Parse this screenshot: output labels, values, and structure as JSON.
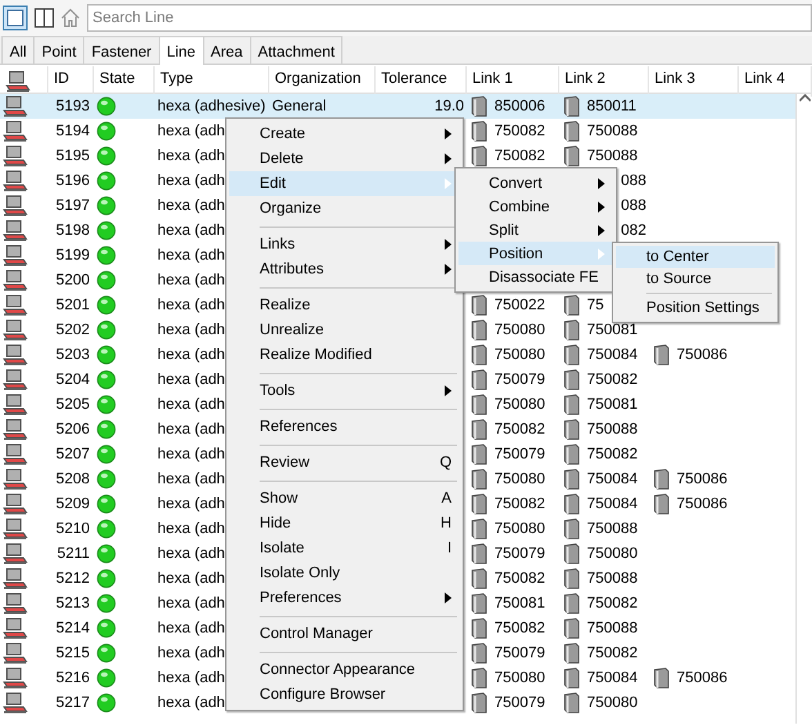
{
  "toolbar": {
    "search": {
      "placeholder": "Search Line"
    }
  },
  "tabs": [
    {
      "label": "All",
      "selected": false
    },
    {
      "label": "Point",
      "selected": false
    },
    {
      "label": "Fastener",
      "selected": false
    },
    {
      "label": "Line",
      "selected": true
    },
    {
      "label": "Area",
      "selected": false
    },
    {
      "label": "Attachment",
      "selected": false
    }
  ],
  "table": {
    "columns": [
      "ID",
      "State",
      "Type",
      "Organization",
      "Tolerance",
      "Link 1",
      "Link 2",
      "Link 3",
      "Link 4"
    ],
    "rows": [
      {
        "id": "5193",
        "type": "hexa (adhesive)",
        "organization": "General",
        "tolerance": "19.0",
        "selected": true,
        "links": [
          {
            "kind": "link",
            "value": "850006"
          },
          {
            "kind": "link",
            "value": "850011"
          }
        ]
      },
      {
        "id": "5194",
        "type": "hexa (adh",
        "selected": false,
        "links": [
          {
            "kind": "link",
            "value": "750082"
          },
          {
            "kind": "link",
            "value": "750088"
          }
        ]
      },
      {
        "id": "5195",
        "type": "hexa (adh",
        "selected": false,
        "links": [
          {
            "kind": "link",
            "value": "750082"
          },
          {
            "kind": "link",
            "value": "750088"
          }
        ]
      },
      {
        "id": "5196",
        "type": "hexa (adh",
        "selected": false,
        "links": [
          {
            "kind": "hidden"
          },
          {
            "kind": "partial",
            "value": "088"
          }
        ]
      },
      {
        "id": "5197",
        "type": "hexa (adh",
        "selected": false,
        "links": [
          {
            "kind": "hidden"
          },
          {
            "kind": "partial",
            "value": "088"
          }
        ]
      },
      {
        "id": "5198",
        "type": "hexa (adh",
        "selected": false,
        "links": [
          {
            "kind": "hidden"
          },
          {
            "kind": "partial",
            "value": "082"
          }
        ]
      },
      {
        "id": "5199",
        "type": "hexa (adh",
        "selected": false,
        "links": []
      },
      {
        "id": "5200",
        "type": "hexa (adh",
        "selected": false,
        "links": []
      },
      {
        "id": "5201",
        "type": "hexa (adh",
        "selected": false,
        "links": [
          {
            "kind": "link",
            "value": "750022"
          },
          {
            "kind": "link",
            "value": "75"
          }
        ]
      },
      {
        "id": "5202",
        "type": "hexa (adh",
        "selected": false,
        "links": [
          {
            "kind": "link",
            "value": "750080"
          },
          {
            "kind": "link",
            "value": "750081"
          }
        ]
      },
      {
        "id": "5203",
        "type": "hexa (adh",
        "selected": false,
        "links": [
          {
            "kind": "link",
            "value": "750080"
          },
          {
            "kind": "link",
            "value": "750084"
          },
          {
            "kind": "link",
            "value": "750086"
          }
        ]
      },
      {
        "id": "5204",
        "type": "hexa (adh",
        "selected": false,
        "links": [
          {
            "kind": "link",
            "value": "750079"
          },
          {
            "kind": "link",
            "value": "750082"
          }
        ]
      },
      {
        "id": "5205",
        "type": "hexa (adh",
        "selected": false,
        "links": [
          {
            "kind": "link",
            "value": "750080"
          },
          {
            "kind": "link",
            "value": "750081"
          }
        ]
      },
      {
        "id": "5206",
        "type": "hexa (adh",
        "selected": false,
        "links": [
          {
            "kind": "link",
            "value": "750082"
          },
          {
            "kind": "link",
            "value": "750088"
          }
        ]
      },
      {
        "id": "5207",
        "type": "hexa (adh",
        "selected": false,
        "links": [
          {
            "kind": "link",
            "value": "750079"
          },
          {
            "kind": "link",
            "value": "750082"
          }
        ]
      },
      {
        "id": "5208",
        "type": "hexa (adh",
        "selected": false,
        "links": [
          {
            "kind": "link",
            "value": "750080"
          },
          {
            "kind": "link",
            "value": "750084"
          },
          {
            "kind": "link",
            "value": "750086"
          }
        ]
      },
      {
        "id": "5209",
        "type": "hexa (adh",
        "selected": false,
        "links": [
          {
            "kind": "link",
            "value": "750082"
          },
          {
            "kind": "link",
            "value": "750084"
          },
          {
            "kind": "link",
            "value": "750086"
          }
        ]
      },
      {
        "id": "5210",
        "type": "hexa (adh",
        "selected": false,
        "links": [
          {
            "kind": "link",
            "value": "750080"
          },
          {
            "kind": "link",
            "value": "750088"
          }
        ]
      },
      {
        "id": "5211",
        "type": "hexa (adh",
        "selected": false,
        "links": [
          {
            "kind": "link",
            "value": "750079"
          },
          {
            "kind": "link",
            "value": "750080"
          }
        ]
      },
      {
        "id": "5212",
        "type": "hexa (adh",
        "selected": false,
        "links": [
          {
            "kind": "link",
            "value": "750082"
          },
          {
            "kind": "link",
            "value": "750088"
          }
        ]
      },
      {
        "id": "5213",
        "type": "hexa (adh",
        "selected": false,
        "links": [
          {
            "kind": "link",
            "value": "750081"
          },
          {
            "kind": "link",
            "value": "750082"
          }
        ]
      },
      {
        "id": "5214",
        "type": "hexa (adh",
        "selected": false,
        "links": [
          {
            "kind": "link",
            "value": "750082"
          },
          {
            "kind": "link",
            "value": "750088"
          }
        ]
      },
      {
        "id": "5215",
        "type": "hexa (adh",
        "selected": false,
        "links": [
          {
            "kind": "link",
            "value": "750079"
          },
          {
            "kind": "link",
            "value": "750082"
          }
        ]
      },
      {
        "id": "5216",
        "type": "hexa (adh",
        "selected": false,
        "links": [
          {
            "kind": "link",
            "value": "750080"
          },
          {
            "kind": "link",
            "value": "750084"
          },
          {
            "kind": "link",
            "value": "750086"
          }
        ]
      },
      {
        "id": "5217",
        "type": "hexa (adh",
        "selected": false,
        "links": [
          {
            "kind": "link",
            "value": "750079"
          },
          {
            "kind": "link",
            "value": "750080"
          }
        ]
      }
    ]
  },
  "context_menu": {
    "items": [
      {
        "kind": "item",
        "label": "Create",
        "submenu": true,
        "selected": false
      },
      {
        "kind": "item",
        "label": "Delete",
        "submenu": true,
        "selected": false
      },
      {
        "kind": "item",
        "label": "Edit",
        "submenu": true,
        "selected": true
      },
      {
        "kind": "item",
        "label": "Organize",
        "submenu": false,
        "selected": false
      },
      {
        "kind": "separator"
      },
      {
        "kind": "item",
        "label": "Links",
        "submenu": true,
        "selected": false
      },
      {
        "kind": "item",
        "label": "Attributes",
        "submenu": true,
        "selected": false
      },
      {
        "kind": "separator"
      },
      {
        "kind": "item",
        "label": "Realize",
        "submenu": false,
        "selected": false
      },
      {
        "kind": "item",
        "label": "Unrealize",
        "submenu": false,
        "selected": false
      },
      {
        "kind": "item",
        "label": "Realize Modified",
        "submenu": false,
        "selected": false
      },
      {
        "kind": "separator"
      },
      {
        "kind": "item",
        "label": "Tools",
        "submenu": true,
        "selected": false
      },
      {
        "kind": "separator"
      },
      {
        "kind": "item",
        "label": "References",
        "submenu": false,
        "selected": false
      },
      {
        "kind": "separator"
      },
      {
        "kind": "item",
        "label": "Review",
        "shortcut": "Q",
        "submenu": false,
        "selected": false
      },
      {
        "kind": "separator"
      },
      {
        "kind": "item",
        "label": "Show",
        "shortcut": "A",
        "submenu": false,
        "selected": false
      },
      {
        "kind": "item",
        "label": "Hide",
        "shortcut": "H",
        "submenu": false,
        "selected": false
      },
      {
        "kind": "item",
        "label": "Isolate",
        "shortcut": "I",
        "submenu": false,
        "selected": false
      },
      {
        "kind": "item",
        "label": "Isolate Only",
        "submenu": false,
        "selected": false
      },
      {
        "kind": "item",
        "label": "Preferences",
        "submenu": true,
        "selected": false
      },
      {
        "kind": "separator"
      },
      {
        "kind": "item",
        "label": "Control Manager",
        "submenu": false,
        "selected": false
      },
      {
        "kind": "separator"
      },
      {
        "kind": "item",
        "label": "Connector Appearance",
        "submenu": false,
        "selected": false
      },
      {
        "kind": "item",
        "label": "Configure Browser",
        "submenu": false,
        "selected": false
      }
    ]
  },
  "edit_submenu": {
    "items": [
      {
        "kind": "item",
        "label": "Convert",
        "submenu": true,
        "selected": false
      },
      {
        "kind": "item",
        "label": "Combine",
        "submenu": true,
        "selected": false
      },
      {
        "kind": "item",
        "label": "Split",
        "submenu": true,
        "selected": false
      },
      {
        "kind": "item",
        "label": "Position",
        "submenu": true,
        "selected": true
      },
      {
        "kind": "item",
        "label": "Disassociate FE",
        "submenu": false,
        "selected": false
      }
    ]
  },
  "position_submenu": {
    "items": [
      {
        "kind": "item",
        "label": "to Center",
        "submenu": false,
        "selected": true
      },
      {
        "kind": "item",
        "label": "to Source",
        "submenu": false,
        "selected": false
      },
      {
        "kind": "separator"
      },
      {
        "kind": "item",
        "label": "Position Settings",
        "submenu": false,
        "selected": false
      }
    ]
  }
}
